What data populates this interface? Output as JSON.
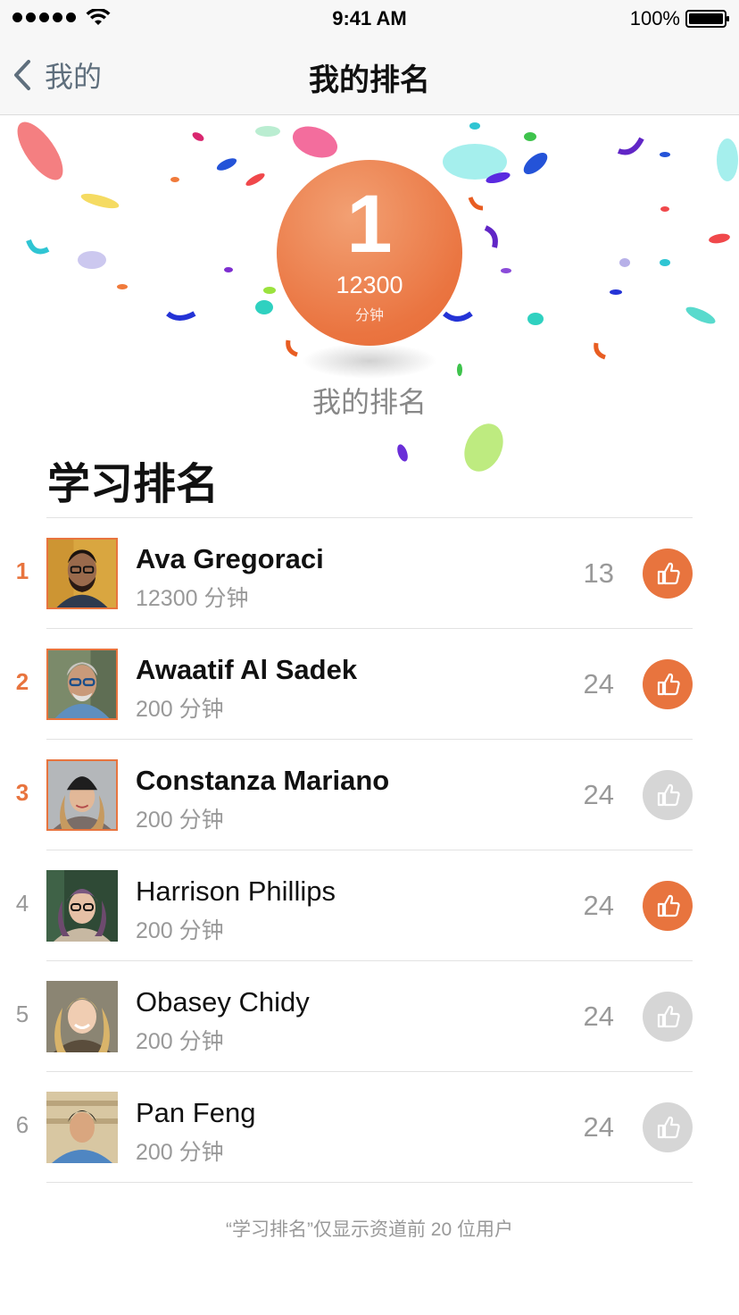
{
  "status_bar": {
    "time": "9:41 AM",
    "battery": "100%"
  },
  "nav": {
    "back_label": "我的",
    "title": "我的排名"
  },
  "hero": {
    "rank": "1",
    "minutes": "12300",
    "unit": "分钟",
    "label": "我的排名",
    "accent_color": "#e8743e"
  },
  "section": {
    "title": "学习排名"
  },
  "rankings": [
    {
      "rank": "1",
      "name": "Ava Gregoraci",
      "minutes": "12300 分钟",
      "likes": "13",
      "liked": true
    },
    {
      "rank": "2",
      "name": "Awaatif Al Sadek",
      "minutes": "200 分钟",
      "likes": "24",
      "liked": true
    },
    {
      "rank": "3",
      "name": "Constanza Mariano",
      "minutes": "200 分钟",
      "likes": "24",
      "liked": false
    },
    {
      "rank": "4",
      "name": "Harrison Phillips",
      "minutes": "200 分钟",
      "likes": "24",
      "liked": true
    },
    {
      "rank": "5",
      "name": "Obasey Chidy",
      "minutes": "200 分钟",
      "likes": "24",
      "liked": false
    },
    {
      "rank": "6",
      "name": "Pan Feng",
      "minutes": "200 分钟",
      "likes": "24",
      "liked": false
    }
  ],
  "footer": {
    "note": "“学习排名”仅显示资道前 20 位用户"
  },
  "icons": {
    "back": "chevron-left-icon",
    "like": "thumbs-up-icon",
    "wifi": "wifi-icon",
    "battery": "battery-icon"
  }
}
